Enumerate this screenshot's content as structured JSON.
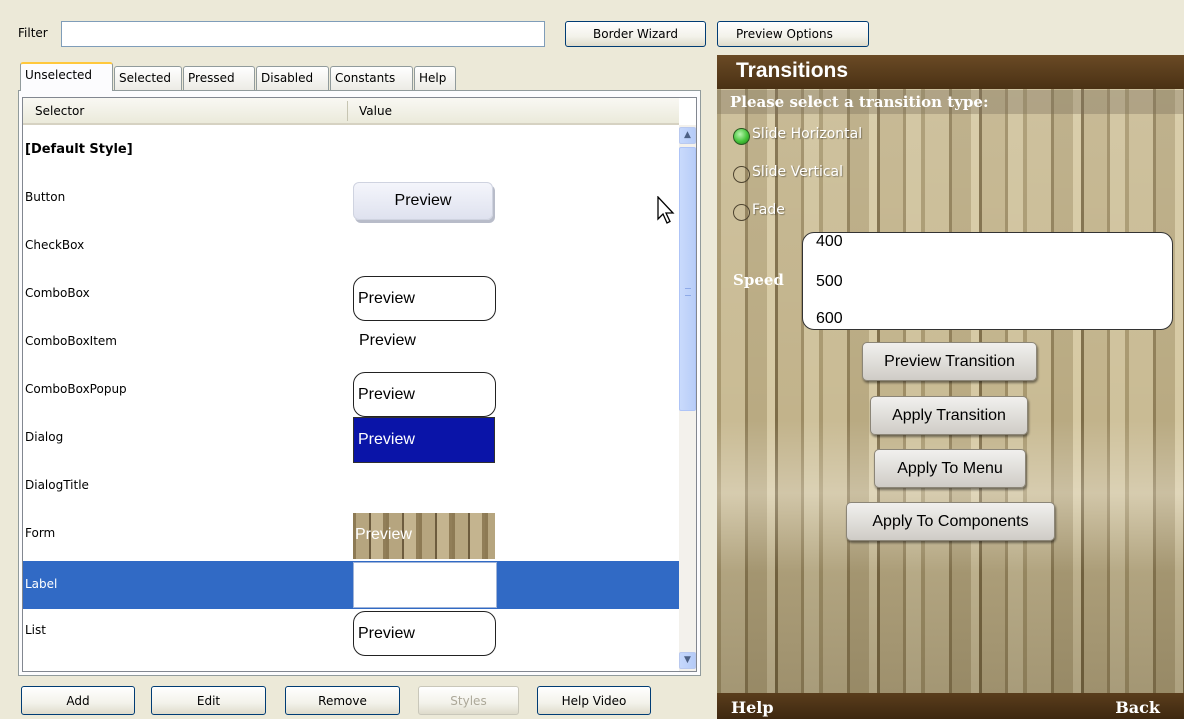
{
  "toolbar": {
    "filter_label": "Filter",
    "filter_value": "",
    "border_wizard": "Border Wizard",
    "preview_options": "Preview Options"
  },
  "tabs": [
    "Unselected",
    "Selected",
    "Pressed",
    "Disabled",
    "Constants",
    "Help"
  ],
  "active_tab": "Unselected",
  "table": {
    "columns": [
      "Selector",
      "Value"
    ],
    "rows": [
      {
        "selector": "[Default Style]",
        "preview": ""
      },
      {
        "selector": "Button",
        "preview": "Preview"
      },
      {
        "selector": "CheckBox",
        "preview": ""
      },
      {
        "selector": "ComboBox",
        "preview": "Preview"
      },
      {
        "selector": "ComboBoxItem",
        "preview": "Preview"
      },
      {
        "selector": "ComboBoxPopup",
        "preview": "Preview"
      },
      {
        "selector": "Dialog",
        "preview": "Preview"
      },
      {
        "selector": "DialogTitle",
        "preview": ""
      },
      {
        "selector": "Form",
        "preview": "Preview"
      },
      {
        "selector": "Label",
        "preview": ""
      },
      {
        "selector": "List",
        "preview": "Preview"
      }
    ],
    "selected_row": "Label"
  },
  "bottom_buttons": {
    "add": "Add",
    "edit": "Edit",
    "remove": "Remove",
    "styles": "Styles",
    "help_video": "Help Video"
  },
  "phone": {
    "title": "Transitions",
    "prompt": "Please select a transition type:",
    "options": [
      {
        "label": "Slide Horizontal",
        "selected": true
      },
      {
        "label": "Slide Vertical",
        "selected": false
      },
      {
        "label": "Fade",
        "selected": false
      }
    ],
    "speed_label": "Speed",
    "speed_values": [
      "400",
      "500",
      "600"
    ],
    "buttons": {
      "preview_transition": "Preview Transition",
      "apply_transition": "Apply Transition",
      "apply_to_menu": "Apply To Menu",
      "apply_to_components": "Apply To Components"
    },
    "softkeys": {
      "left": "Help",
      "right": "Back"
    }
  },
  "colors": {
    "selection": "#316ac5",
    "dialog_preview_bg": "#0a14a8",
    "title_bar": "#5a3d1c",
    "window_bg": "#ece9d8"
  }
}
